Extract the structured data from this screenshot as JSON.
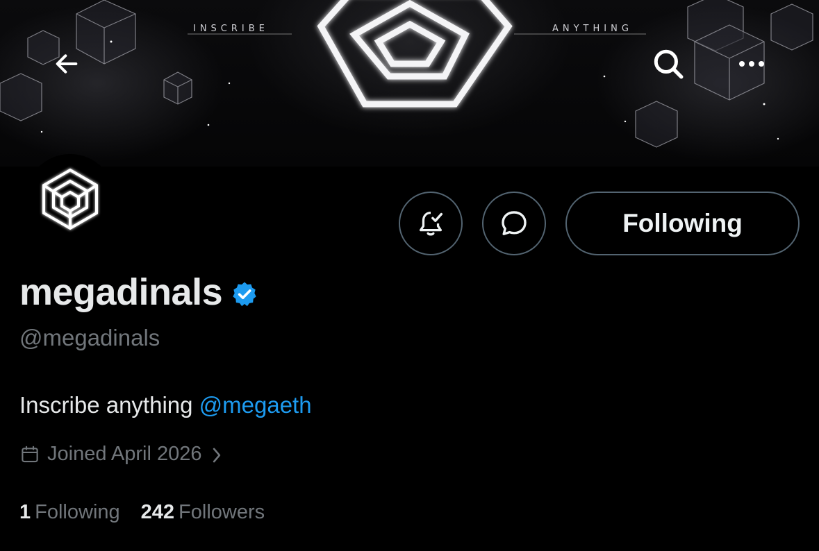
{
  "banner": {
    "left_word": "INSCRIBE",
    "right_word": "ANYTHING"
  },
  "nav": {
    "back_icon": "arrow-left-icon",
    "search_icon": "search-icon",
    "more_icon": "more-horizontal-icon"
  },
  "actions": {
    "notify_icon": "bell-check-icon",
    "message_icon": "message-bubble-icon",
    "follow_label": "Following"
  },
  "profile": {
    "display_name": "megadinals",
    "handle": "@megadinals",
    "verified_color": "#1d9bf0",
    "bio_text": "Inscribe anything ",
    "bio_mention": "@megaeth",
    "joined": "Joined April 2026"
  },
  "stats": {
    "following_count": "1",
    "following_label": "Following",
    "followers_count": "242",
    "followers_label": "Followers"
  },
  "colors": {
    "background": "#000000",
    "accent": "#1d9bf0",
    "muted_text": "#71767b",
    "border": "#536471"
  }
}
